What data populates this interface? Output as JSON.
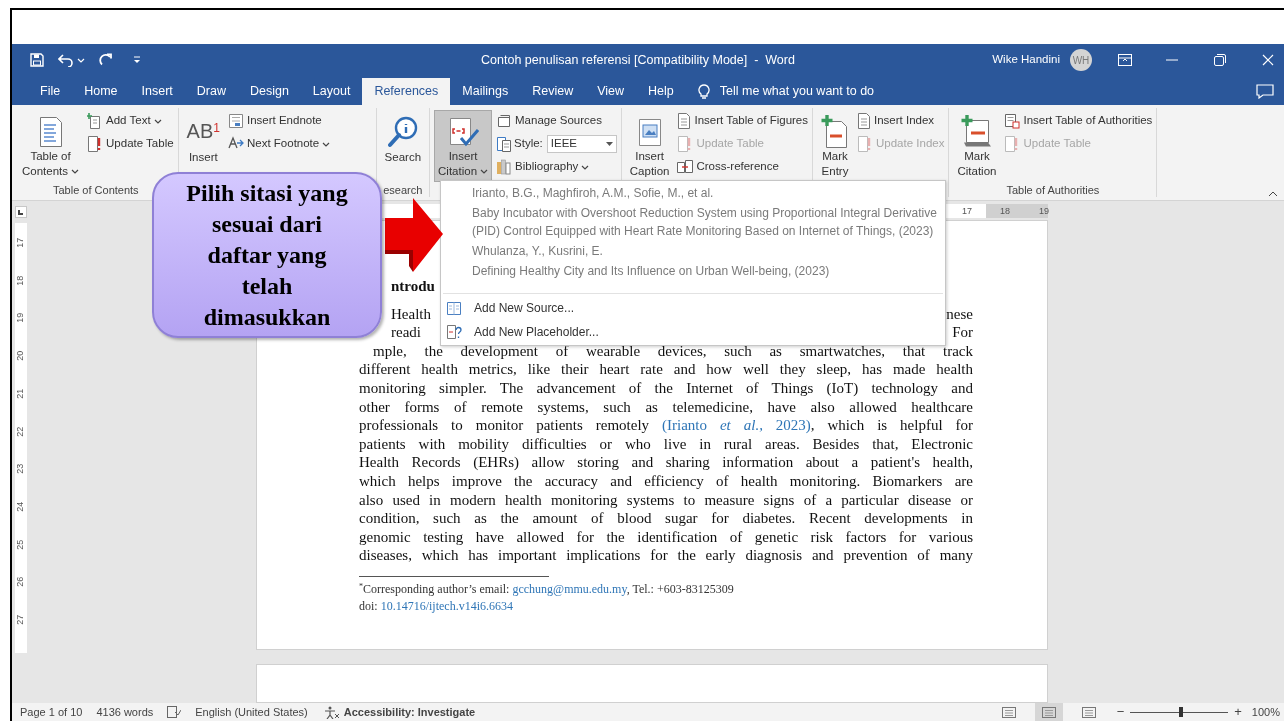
{
  "window": {
    "title": "Contoh penulisan referensi [Compatibility Mode]  -  Word",
    "user": "Wike Handini",
    "avatar_initials": "WH"
  },
  "tabs": [
    {
      "label": "File",
      "selected": false
    },
    {
      "label": "Home",
      "selected": false
    },
    {
      "label": "Insert",
      "selected": false
    },
    {
      "label": "Draw",
      "selected": false
    },
    {
      "label": "Design",
      "selected": false
    },
    {
      "label": "Layout",
      "selected": false
    },
    {
      "label": "References",
      "selected": true
    },
    {
      "label": "Mailings",
      "selected": false
    },
    {
      "label": "Review",
      "selected": false
    },
    {
      "label": "View",
      "selected": false
    },
    {
      "label": "Help",
      "selected": false
    }
  ],
  "tell_me": "Tell me what you want to do",
  "ribbon": {
    "groups": [
      {
        "label": "Table of Contents",
        "large": [
          {
            "lines": [
              "Table of",
              "Contents"
            ],
            "dropdown": true,
            "pressed": false
          }
        ],
        "small": [
          {
            "kind": "button",
            "label": "Add Text",
            "dropdown": true,
            "disabled": false
          },
          {
            "kind": "button",
            "label": "Update Table",
            "dropdown": false,
            "disabled": false
          }
        ]
      },
      {
        "large": [
          {
            "icon_text": "AB$^{1}$",
            "lines": [
              "Insert"
            ],
            "dropdown": false,
            "pressed": false
          }
        ],
        "small": [
          {
            "kind": "button",
            "label": "Insert Endnote",
            "dropdown": false,
            "disabled": false
          },
          {
            "kind": "button",
            "label": "Next Footnote",
            "dropdown": true,
            "disabled": false
          }
        ]
      },
      {
        "label": "esearch",
        "large": [
          {
            "lines": [
              "Search"
            ],
            "dropdown": false,
            "pressed": false
          }
        ]
      },
      {
        "large": [
          {
            "lines": [
              "Insert",
              "Citation"
            ],
            "dropdown": true,
            "pressed": true
          }
        ],
        "small": [
          {
            "kind": "button",
            "label": "Manage Sources",
            "dropdown": false,
            "disabled": false
          },
          {
            "kind": "combo",
            "label": "Style:",
            "value": "IEEE"
          },
          {
            "kind": "button",
            "label": "Bibliography",
            "dropdown": true,
            "disabled": false
          }
        ]
      },
      {
        "large": [
          {
            "lines": [
              "Insert",
              "Caption"
            ],
            "dropdown": false,
            "pressed": false
          }
        ],
        "small": [
          {
            "kind": "button",
            "label": "Insert Table of Figures",
            "dropdown": false,
            "disabled": false
          },
          {
            "kind": "button",
            "label": "Update Table",
            "dropdown": false,
            "disabled": true
          },
          {
            "kind": "button",
            "label": "Cross-reference",
            "dropdown": false,
            "disabled": false
          }
        ]
      },
      {
        "large": [
          {
            "lines": [
              "Mark",
              "Entry"
            ],
            "dropdown": false,
            "pressed": false
          }
        ],
        "small": [
          {
            "kind": "button",
            "label": "Insert Index",
            "dropdown": false,
            "disabled": false
          },
          {
            "kind": "button",
            "label": "Update Index",
            "dropdown": false,
            "disabled": true
          }
        ]
      },
      {
        "label": "Table of Authorities",
        "large": [
          {
            "lines": [
              "Mark",
              "Citation"
            ],
            "dropdown": false,
            "pressed": false
          }
        ],
        "small": [
          {
            "kind": "button",
            "label": "Insert Table of Authorities",
            "dropdown": false,
            "disabled": false
          },
          {
            "kind": "button",
            "label": "Update Table",
            "dropdown": false,
            "disabled": true
          }
        ]
      }
    ]
  },
  "citation_menu": {
    "citations": [
      {
        "author": "Irianto, B.G., Maghfiroh, A.M., Sofie, M., et al.",
        "title_lines": [
          "Baby Incubator with Overshoot Reduction System using Proportional Integral Derivative",
          "(PID) Control Equipped with Heart Rate Monitoring Based on Internet of Things, (2023)"
        ]
      },
      {
        "author": "Whulanza, Y.,  Kusrini, E.",
        "title_lines": [
          "Defining Healthy City and Its Influence on Urban Well-being, (2023)"
        ]
      }
    ],
    "actions": [
      {
        "label": "Add New Source..."
      },
      {
        "label": "Add New Placeholder..."
      }
    ]
  },
  "callout": {
    "lines": [
      "Pilih sitasi yang",
      "sesuai dari",
      "daftar yang",
      "telah",
      "dimasukkan"
    ]
  },
  "horizontal_ruler": [
    "17",
    "18",
    "19"
  ],
  "vertical_ruler": [
    "17",
    "18",
    "19",
    "20",
    "21",
    "22",
    "23",
    "24",
    "25",
    "26",
    "27"
  ],
  "document": {
    "heading": "ntrodu",
    "partial_lines": [
      {
        "left": "Health",
        "right": "nese"
      },
      {
        "left": "readi",
        "right": "For"
      }
    ],
    "lines": [
      {
        "kind": "plain",
        "text": "mple, the development of wearable devices, such as smartwatches, that track"
      },
      {
        "kind": "plain",
        "text": "different health metrics, like their heart rate and how well they sleep, has made health"
      },
      {
        "kind": "plain",
        "text": "monitoring simpler. The advancement of the Internet of Things (IoT) technology and"
      },
      {
        "kind": "plain",
        "text": "other forms of remote systems, such as telemedicine, have also allowed healthcare"
      },
      {
        "kind": "citation",
        "before": "professionals to monitor patients remotely ",
        "citation": "(Irianto *et al.,* 2023)",
        "after": ", which is helpful for"
      },
      {
        "kind": "plain",
        "text": "patients with mobility difficulties or who live in rural areas. Besides that, Electronic"
      },
      {
        "kind": "plain",
        "text": "Health Records (EHRs) allow storing and sharing information about a patient's health,"
      },
      {
        "kind": "plain",
        "text": "which helps improve the accuracy and efficiency of health monitoring. Biomarkers are"
      },
      {
        "kind": "plain",
        "text": "also used in modern health monitoring systems to measure signs of a particular disease or"
      },
      {
        "kind": "plain",
        "text": "condition, such as the amount of blood sugar for diabetes. Recent developments in"
      },
      {
        "kind": "plain",
        "text": "genomic testing have allowed for the identification of genetic risk factors for various"
      },
      {
        "kind": "plain",
        "text": "diseases, which has important implications for the early diagnosis and prevention of many"
      }
    ],
    "footnote": {
      "prefix": "$^{*}$Corresponding author’s email: ",
      "email": "gcchung@mmu.edu.my",
      "suffix": ", Tel.: +603-83125309",
      "doi_label": "doi: ",
      "doi": "10.14716/ijtech.v14i6.6634"
    }
  },
  "status_bar": {
    "page": "Page 1 of 10",
    "words": "4136 words",
    "language": "English (United States)",
    "accessibility": "Accessibility: Investigate",
    "views": [
      {
        "selected": false
      },
      {
        "selected": true
      },
      {
        "selected": false
      }
    ],
    "zoom": {
      "minus": "−",
      "level": 0.52,
      "plus": "+",
      "percent": "100%"
    }
  }
}
